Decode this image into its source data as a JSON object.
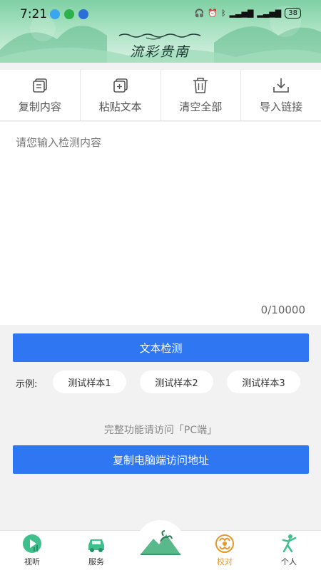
{
  "status_bar": {
    "time": "7:21",
    "battery": "38"
  },
  "header": {
    "logo_text": "流彩贵南"
  },
  "toolbar": {
    "items": [
      {
        "label": "复制内容",
        "icon": "copy-icon"
      },
      {
        "label": "粘贴文本",
        "icon": "paste-icon"
      },
      {
        "label": "清空全部",
        "icon": "trash-icon"
      },
      {
        "label": "导入链接",
        "icon": "import-icon"
      }
    ]
  },
  "editor": {
    "placeholder": "请您输入检测内容",
    "value": "",
    "counter": "0/10000"
  },
  "detect_button": "文本检测",
  "examples": {
    "label": "示例:",
    "items": [
      "测试样本1",
      "测试样本2",
      "测试样本3"
    ]
  },
  "pc_hint": "完整功能请访问「PC端」",
  "copy_url_button": "复制电脑端访问地址",
  "bottom_nav": {
    "items": [
      {
        "label": "视听",
        "icon": "media-icon"
      },
      {
        "label": "服务",
        "icon": "car-icon"
      },
      {
        "label": "",
        "icon": "home-mountain-icon"
      },
      {
        "label": "校对",
        "icon": "proofread-icon",
        "active": true
      },
      {
        "label": "个人",
        "icon": "person-icon"
      }
    ]
  },
  "colors": {
    "primary": "#2f77f2",
    "active_nav": "#e6972c",
    "header_green": "#7fd0a4"
  }
}
